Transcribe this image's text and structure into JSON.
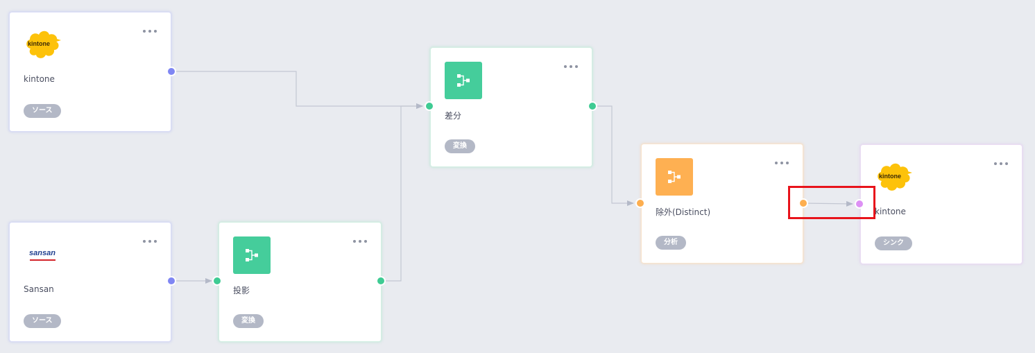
{
  "nodes": [
    {
      "id": "kintone-source",
      "title": "kintone",
      "badge": "ソース",
      "logo_text": "kintone",
      "logo": "kintone-logo"
    },
    {
      "id": "sansan-source",
      "title": "Sansan",
      "badge": "ソース",
      "logo_text": "sansan",
      "logo": "sansan-logo"
    },
    {
      "id": "projection",
      "title": "投影",
      "badge": "変換",
      "icon": "branch-icon"
    },
    {
      "id": "diff",
      "title": "差分",
      "badge": "変換",
      "icon": "branch-icon"
    },
    {
      "id": "distinct",
      "title": "除外(Distinct)",
      "badge": "分析",
      "icon": "branch-icon"
    },
    {
      "id": "kintone-sink",
      "title": "kintone",
      "badge": "シンク",
      "logo_text": "kintone",
      "logo": "kintone-logo"
    }
  ],
  "colors": {
    "background": "#e9ebf0",
    "source_port": "#7f86f3",
    "transform_port": "#3ecb93",
    "analysis_port": "#fdae4f",
    "sink_port": "#dd91f4",
    "transform_tile": "#45cd9b",
    "analysis_tile": "#feb052",
    "badge": "#b3b8c6",
    "highlight": "#e8131b",
    "kintone_logo": "#fdc20a"
  }
}
